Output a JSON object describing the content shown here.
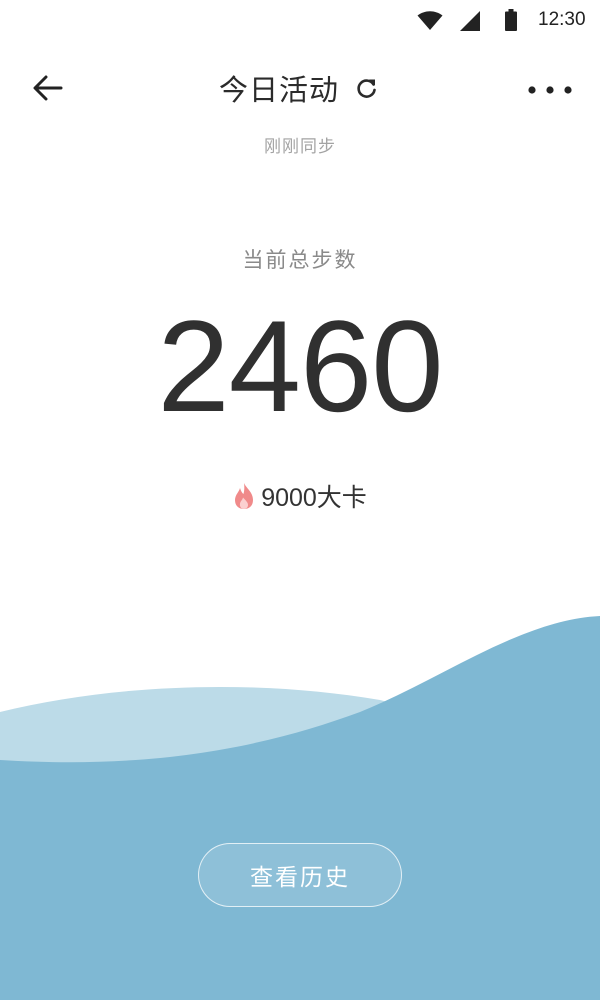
{
  "status_bar": {
    "time": "12:30",
    "icons": [
      "wifi-icon",
      "cell-signal-icon",
      "battery-icon"
    ]
  },
  "header": {
    "title": "今日活动",
    "sync_status": "刚刚同步",
    "icons": {
      "back": "arrow-left-icon",
      "refresh": "refresh-icon",
      "more": "more-horizontal-icon"
    }
  },
  "stats": {
    "steps_label": "当前总步数",
    "steps_value": "2460",
    "calories": "9000大卡",
    "calories_icon": "flame-icon"
  },
  "actions": {
    "history_label": "查看历史"
  },
  "colors": {
    "wave_dark": "#7fb8d3",
    "wave_light": "#bcdbe8",
    "flame": "#f08a8a",
    "text_primary": "#303030",
    "text_secondary": "#8a8a8a"
  }
}
